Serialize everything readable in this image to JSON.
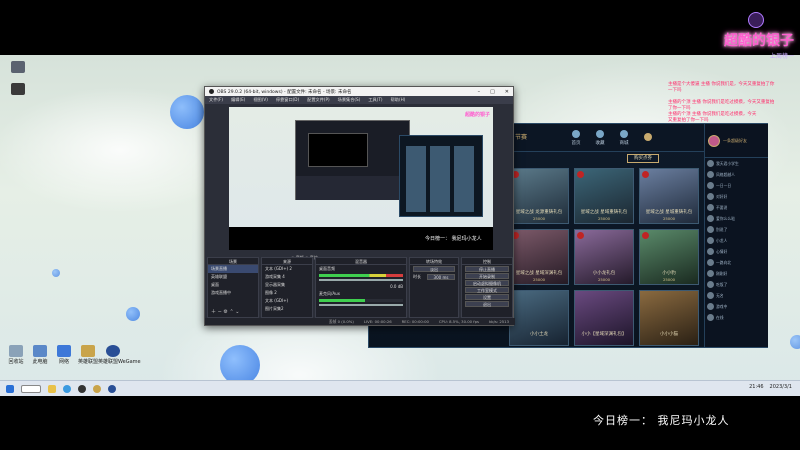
{
  "overlay": {
    "logo_title": "超酷的银子",
    "logo_sub": "上周榜一",
    "caption": "今日榜一：  我尼玛小龙人",
    "chat": [
      {
        "text": "主播是个大傻逼 主播 你说我们是，今天又重复拍了你一下吗",
        "color": "#ff2a6a"
      },
      {
        "text": "主播的个顶 主播 你说我们是吃过摸摸，今天又重复拍了你一下吗",
        "color": "#ff2a6a"
      },
      {
        "text": "主播的个顶 主播 你说我们是吃过摸摸，今天又重复拍了你一下吗",
        "color": "#ff2a6a"
      }
    ],
    "colors": {
      "accent": "#ff5fd0",
      "stream_bar": "#000000"
    }
  },
  "desktop": {
    "icons": [
      {
        "label": "回收站",
        "icon": "recycle-bin-icon",
        "color": "#8aa2b8"
      },
      {
        "label": "此电脑",
        "icon": "computer-icon",
        "color": "#5a88c8"
      },
      {
        "label": "网络",
        "icon": "network-icon",
        "color": "#3d78d8"
      },
      {
        "label": "英雄联盟",
        "icon": "lol-icon",
        "color": "#c9a44a"
      },
      {
        "label": "英雄联盟WeGame",
        "icon": "wegame-icon",
        "color": "#294f96"
      }
    ],
    "top_left_icons": [
      {
        "label": "",
        "icon": "file-icon"
      },
      {
        "label": "",
        "icon": "file-icon"
      }
    ]
  },
  "taskbar": {
    "apps": [
      "start-icon",
      "search-icon",
      "folder-icon",
      "browser-icon",
      "obs-icon",
      "lol-icon",
      "wegame-icon"
    ],
    "time": "21:46",
    "date": "2023/3/1"
  },
  "obs": {
    "title": "OBS 29.0.2 (64-bit, windows) - 配置文件: 未命名 - 场景: 未命名",
    "menu": [
      "文件(F)",
      "编辑(E)",
      "视图(V)",
      "停靠窗口(D)",
      "配置文件(P)",
      "场景集合(S)",
      "工具(T)",
      "帮助(H)"
    ],
    "preview_caption": "今日榜一：  我尼玛小龙人",
    "preview_logo": "超酷的银子",
    "docks": {
      "scenes": {
        "title": "场景",
        "items": [
          "场景直播",
          "英雄联盟",
          "桌面",
          "游戏直播中"
        ]
      },
      "sources": {
        "title": "来源",
        "items": [
          "文本 (GDI+) 2",
          "游戏采集 4",
          "显示器采集",
          "图像 2",
          "文本 (GDI+)",
          "图片采集2"
        ]
      },
      "mixer": {
        "title": "混音器",
        "tracks": [
          {
            "name": "桌面音频",
            "level": "0.0 dB"
          },
          {
            "name": "麦克风/Aux",
            "level": "0.0 dB"
          }
        ]
      },
      "transitions": {
        "title": "转场特效",
        "type": "淡出",
        "duration_label": "时长",
        "duration": "300 ms"
      },
      "controls": {
        "title": "控制",
        "buttons": [
          "停止直播",
          "开始录制",
          "启动虚拟摄像机",
          "工作室模式",
          "设置",
          "退出"
        ]
      }
    },
    "status": [
      "丢帧 0 (0.0%)",
      "LIVE: 00:00:26",
      "REC: 00:00:00",
      "CPU: 8.5%, 30.00 fps",
      "kb/s: 2513"
    ]
  },
  "game": {
    "tabs": [
      {
        "label": "首页",
        "icon": "home-icon"
      },
      {
        "label": "收藏",
        "icon": "collection-icon"
      },
      {
        "label": "商城",
        "icon": "store-icon"
      },
      {
        "label": "",
        "icon": "chest-icon"
      }
    ],
    "header_title": "节赛",
    "buy_button": "购买点券",
    "cards": [
      {
        "name": "星域之战 龙源重铸礼包",
        "price": "25000",
        "color": "#5b7a8a"
      },
      {
        "name": "星域之战 星域重铸礼包",
        "price": "25000",
        "color": "#3c6678"
      },
      {
        "name": "星域之战 星城重铸礼包",
        "price": "25000",
        "color": "#6b7fa0"
      },
      {
        "name": "星域之战 星域深渊礼包",
        "price": "25000",
        "color": "#7d5a6a"
      },
      {
        "name": "小小龙礼包",
        "price": "25000",
        "color": "#8a6a9a"
      },
      {
        "name": "小小豹",
        "price": "25000",
        "color": "#5a8a6a"
      },
      {
        "name": "小小土龙",
        "price": "",
        "color": "#4a6a80"
      },
      {
        "name": "小小【星域深渊礼包】",
        "price": "",
        "color": "#6a4a80"
      },
      {
        "name": "小小小猫",
        "price": "",
        "color": "#8a6a40"
      }
    ],
    "friends_header": "一条超级好友",
    "friends": [
      "我天君小学生",
      "风格超越人",
      "一日一日",
      "对好好",
      "不要说",
      "爱你么么哒",
      "别说了",
      "小龙人",
      "心情好",
      "一路向北",
      "刚刚好",
      "吃饭了",
      "无名",
      "游戏中",
      "在线"
    ],
    "colors": {
      "frame": "#2b4a66",
      "gold": "#c8aa6e"
    }
  }
}
